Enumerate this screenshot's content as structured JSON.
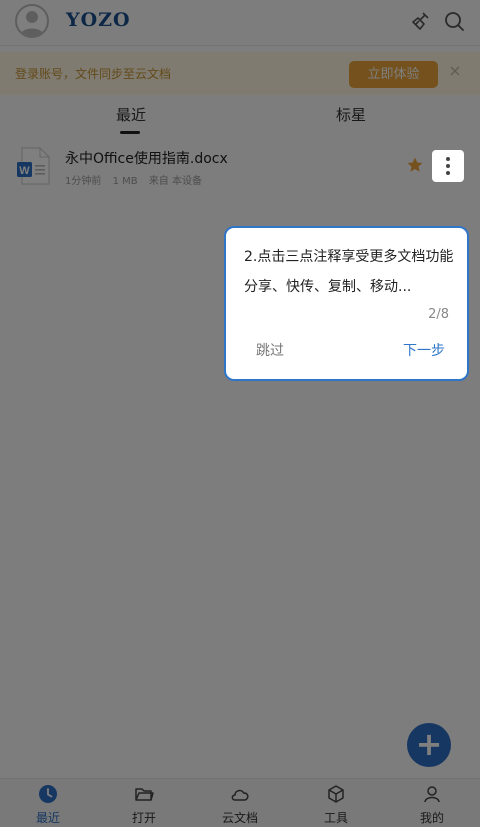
{
  "header": {
    "logo": "YOZO",
    "icons": [
      "avatar-icon",
      "broom-icon",
      "search-icon"
    ]
  },
  "banner": {
    "text": "登录账号，文件同步至云文档",
    "button": "立即体验",
    "close": "×"
  },
  "tabs": [
    {
      "label": "最近",
      "active": true
    },
    {
      "label": "标星",
      "active": false
    }
  ],
  "file": {
    "name": "永中Office使用指南.docx",
    "time": "1分钟前",
    "size": "1 MB",
    "source": "来自 本设备",
    "starred": true
  },
  "guide": {
    "line1": "2.点击三点注释享受更多文档功能",
    "line2": "分享、快传、复制、移动...",
    "page": "2/8",
    "skip": "跳过",
    "next": "下一步"
  },
  "fab": {
    "label": "+"
  },
  "bottom_nav": [
    {
      "label": "最近",
      "icon": "clock-icon",
      "active": true
    },
    {
      "label": "打开",
      "icon": "folder-icon",
      "active": false
    },
    {
      "label": "云文档",
      "icon": "cloud-icon",
      "active": false
    },
    {
      "label": "工具",
      "icon": "cube-icon",
      "active": false
    },
    {
      "label": "我的",
      "icon": "person-icon",
      "active": false
    }
  ],
  "colors": {
    "accent": "#2f76c9",
    "banner_bg": "#fff6e0",
    "banner_button": "#e8a33a",
    "star": "#e8a33a",
    "logo": "#1a4e8c"
  }
}
